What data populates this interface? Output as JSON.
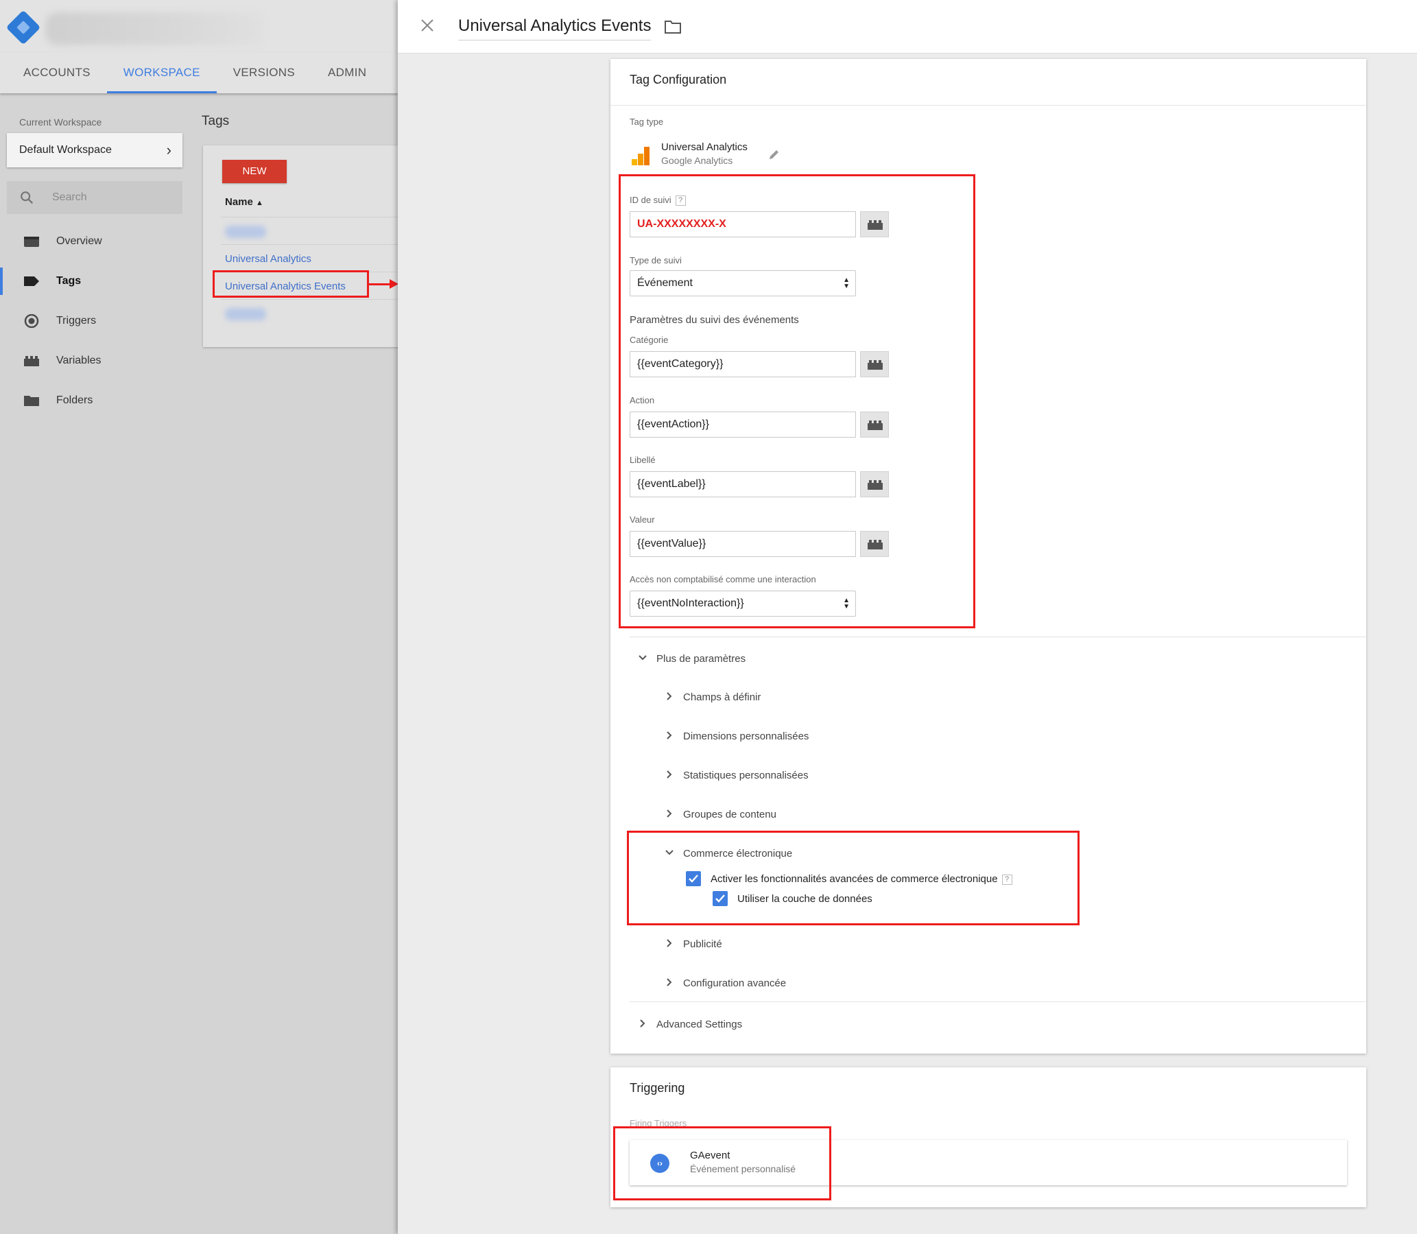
{
  "app": {
    "tabs": [
      {
        "label": "ACCOUNTS",
        "active": false
      },
      {
        "label": "WORKSPACE",
        "active": true
      },
      {
        "label": "VERSIONS",
        "active": false
      },
      {
        "label": "ADMIN",
        "active": false
      }
    ]
  },
  "sidebar": {
    "current_workspace_label": "Current Workspace",
    "workspace_name": "Default Workspace",
    "search_placeholder": "Search",
    "items": [
      {
        "label": "Overview",
        "icon": "overview-icon",
        "active": false
      },
      {
        "label": "Tags",
        "icon": "tag-icon",
        "active": true
      },
      {
        "label": "Triggers",
        "icon": "trigger-icon",
        "active": false
      },
      {
        "label": "Variables",
        "icon": "variables-icon",
        "active": false
      },
      {
        "label": "Folders",
        "icon": "folder-icon",
        "active": false
      }
    ]
  },
  "tags_list": {
    "heading": "Tags",
    "new_button": "NEW",
    "column_header": "Name",
    "rows": [
      "Universal Analytics",
      "Universal Analytics Events"
    ]
  },
  "panel": {
    "title": "Universal Analytics Events",
    "tag_config": {
      "title": "Tag Configuration",
      "tag_type_label": "Tag type",
      "tag_type_name": "Universal Analytics",
      "tag_type_vendor": "Google Analytics",
      "tracking_id_label": "ID de suivi",
      "tracking_id_value": "UA-XXXXXXXX-X",
      "track_type_label": "Type de suivi",
      "track_type_value": "Événement",
      "event_params_heading": "Paramètres du suivi des événements",
      "category_label": "Catégorie",
      "category_value": "{{eventCategory}}",
      "action_label": "Action",
      "action_value": "{{eventAction}}",
      "label_label": "Libellé",
      "label_value": "{{eventLabel}}",
      "value_label": "Valeur",
      "value_value": "{{eventValue}}",
      "non_interaction_label": "Accès non comptabilisé comme une interaction",
      "non_interaction_value": "{{eventNoInteraction}}",
      "more_settings": "Plus de paramètres",
      "fields_to_set": "Champs à définir",
      "custom_dimensions": "Dimensions personnalisées",
      "custom_metrics": "Statistiques personnalisées",
      "content_groups": "Groupes de contenu",
      "ecommerce": "Commerce électronique",
      "enhanced_ecommerce": "Activer les fonctionnalités avancées de commerce électronique",
      "use_data_layer": "Utiliser la couche de données",
      "advertising": "Publicité",
      "advanced_config": "Configuration avancée",
      "advanced_settings": "Advanced Settings"
    },
    "triggering": {
      "title": "Triggering",
      "firing_label": "Firing Triggers",
      "trigger_name": "GAevent",
      "trigger_type": "Événement personnalisé"
    }
  },
  "colors": {
    "accent": "#3f7ee0",
    "annotation_red": "#ee1c1c",
    "new_button": "#d23a2b"
  }
}
